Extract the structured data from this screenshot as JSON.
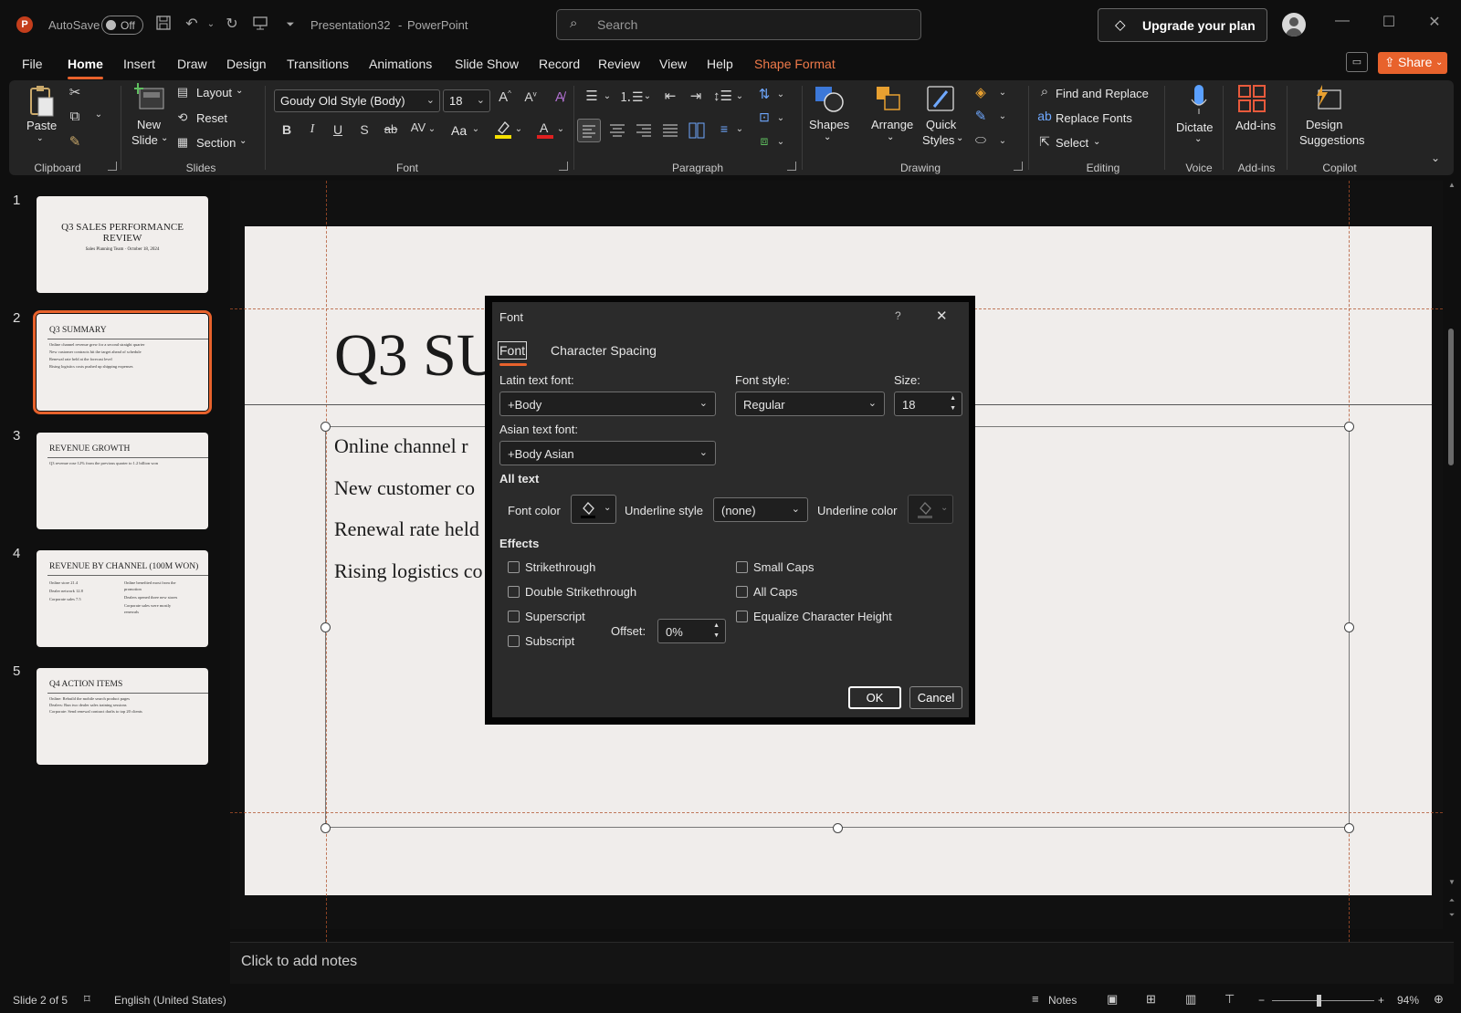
{
  "titlebar": {
    "autosave_label": "AutoSave",
    "autosave_state": "Off",
    "document_title": "Presentation32",
    "separator": "-",
    "app_name": "PowerPoint",
    "search_placeholder": "Search",
    "upgrade_label": "Upgrade your plan"
  },
  "menu": {
    "tabs": [
      "File",
      "Home",
      "Insert",
      "Draw",
      "Design",
      "Transitions",
      "Animations",
      "Slide Show",
      "Record",
      "Review",
      "View",
      "Help",
      "Shape Format"
    ],
    "active_tab": "Home",
    "share_label": "Share"
  },
  "ribbon": {
    "clipboard": {
      "label": "Clipboard",
      "paste": "Paste"
    },
    "slides": {
      "label": "Slides",
      "new_slide_1": "New",
      "new_slide_2": "Slide",
      "layout": "Layout",
      "reset": "Reset",
      "section": "Section"
    },
    "font": {
      "label": "Font",
      "font_name": "Goudy Old Style (Body)",
      "font_size": "18",
      "aa": "Aa"
    },
    "paragraph": {
      "label": "Paragraph"
    },
    "drawing": {
      "label": "Drawing",
      "shapes": "Shapes",
      "arrange": "Arrange",
      "quick_styles_1": "Quick",
      "quick_styles_2": "Styles"
    },
    "editing": {
      "label": "Editing",
      "find_replace": "Find and Replace",
      "replace_fonts": "Replace Fonts",
      "select": "Select"
    },
    "voice": {
      "label": "Voice",
      "dictate": "Dictate"
    },
    "addins": {
      "label": "Add-ins",
      "addins": "Add-ins"
    },
    "copilot": {
      "label": "Copilot",
      "design_1": "Design",
      "design_2": "Suggestions"
    }
  },
  "thumbnails": [
    {
      "num": "1",
      "title_1": "Q3 SALES PERFORMANCE",
      "title_2": "REVIEW",
      "subtitle": "Sales Planning Team · October 18, 2024"
    },
    {
      "num": "2",
      "title": "Q3 SUMMARY",
      "lines": [
        "Online channel revenue grew for a second straight quarter",
        "New customer contracts hit the target ahead of schedule",
        "Renewal rate held at the forecast level",
        "Rising logistics costs pushed up shipping expenses"
      ]
    },
    {
      "num": "3",
      "title": "REVENUE GROWTH",
      "lines": [
        "Q3 revenue rose 12% from the previous quarter to 1.2 billion won"
      ]
    },
    {
      "num": "4",
      "title": "REVENUE BY CHANNEL (100M WON)",
      "left": [
        "Online store 21.4",
        "Dealer network 12.8",
        "Corporate sales 7.5"
      ],
      "right": [
        "Online benefited most from the",
        "promotion",
        "Dealers opened three new stores",
        "Corporate sales were mostly",
        "renewals"
      ]
    },
    {
      "num": "5",
      "title": "Q4 ACTION ITEMS",
      "lines": [
        "Online: Rebuild the mobile search product pages",
        "Dealers: Run two dealer sales training sessions",
        "Corporate: Send renewal contract drafts to top 20 clients"
      ]
    }
  ],
  "slide": {
    "title": "Q3 SU",
    "bullets": [
      "Online channel r",
      "New customer co",
      "Renewal rate held",
      "Rising logistics co"
    ]
  },
  "notes_placeholder": "Click to add notes",
  "status": {
    "slide_info": "Slide 2 of 5",
    "language": "English (United States)",
    "notes": "Notes",
    "zoom": "94%"
  },
  "font_dialog": {
    "title": "Font",
    "help": "?",
    "tabs": [
      "Font",
      "Character Spacing"
    ],
    "latin_label": "Latin text font:",
    "latin_value": "+Body",
    "style_label": "Font style:",
    "style_value": "Regular",
    "size_label": "Size:",
    "size_value": "18",
    "asian_label": "Asian text font:",
    "asian_value": "+Body Asian",
    "all_text_heading": "All text",
    "font_color_label": "Font color",
    "underline_style_label": "Underline style",
    "underline_style_value": "(none)",
    "underline_color_label": "Underline color",
    "effects_heading": "Effects",
    "effects_left": [
      "Strikethrough",
      "Double Strikethrough",
      "Superscript",
      "Subscript"
    ],
    "effects_right": [
      "Small Caps",
      "All Caps",
      "Equalize Character Height"
    ],
    "offset_label": "Offset:",
    "offset_value": "0%",
    "ok": "OK",
    "cancel": "Cancel"
  },
  "colors": {
    "accent": "#e8622c",
    "app_background": "#0f0f0f",
    "ribbon_background": "#242424",
    "dialog_background": "#2b2b2b",
    "slide_background": "#f0edeb"
  }
}
